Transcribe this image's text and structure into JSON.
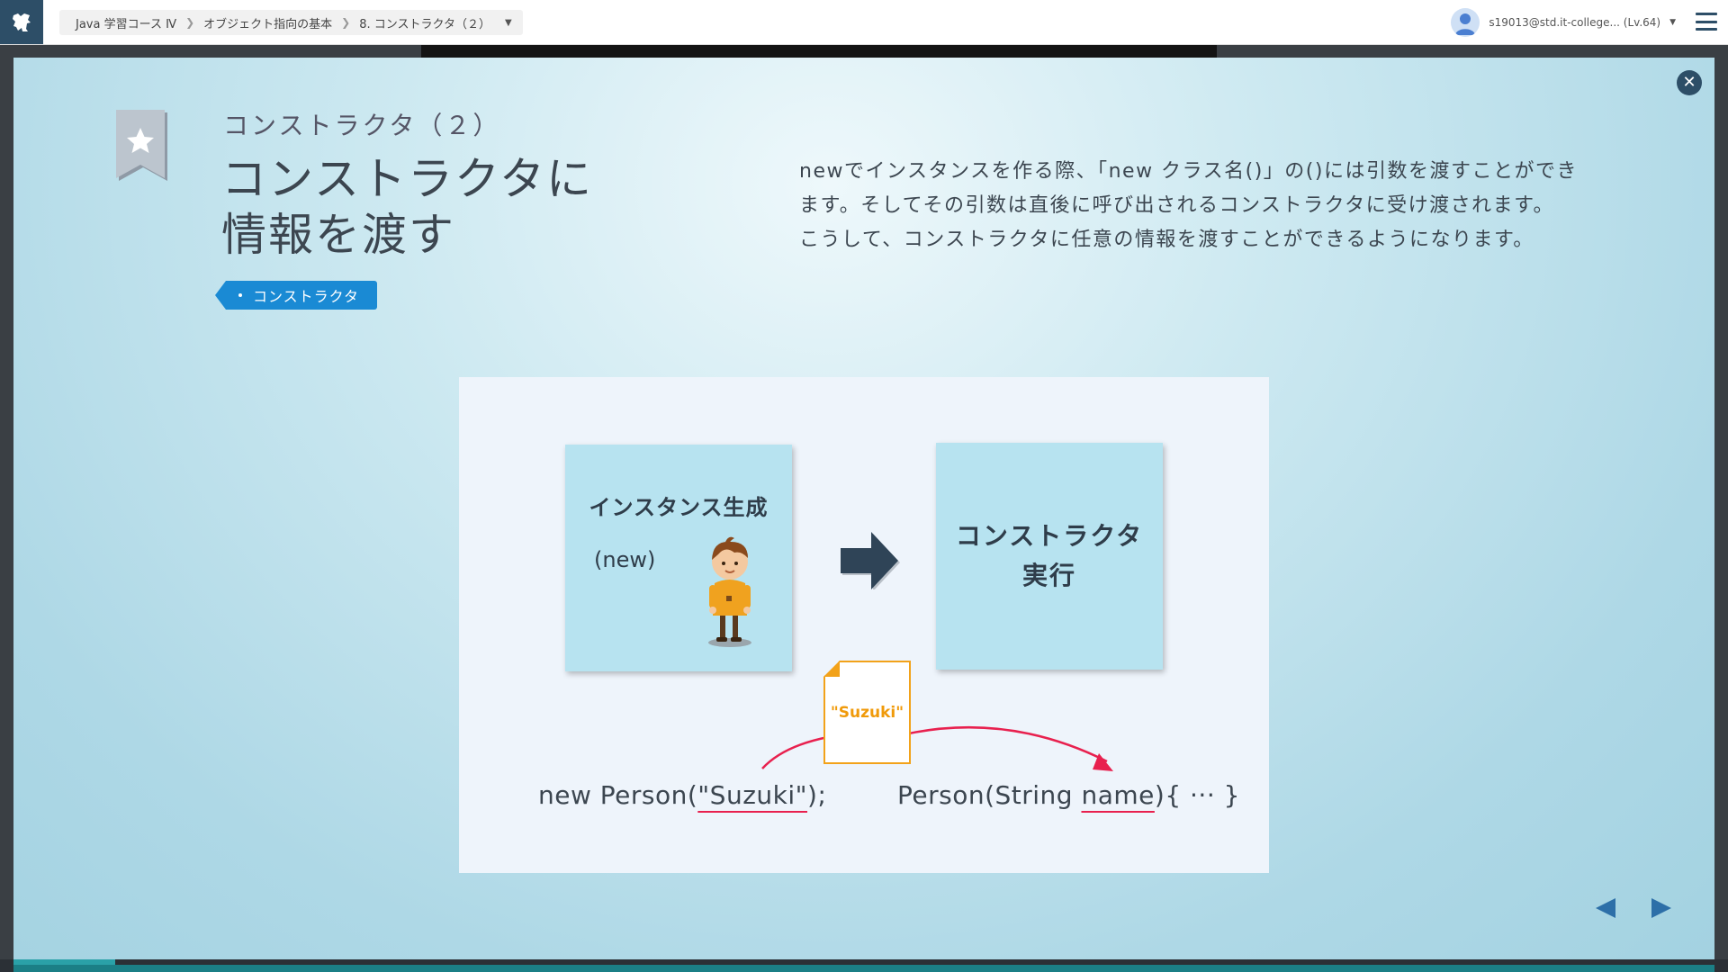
{
  "topbar": {
    "breadcrumb": [
      "Java 学習コース Ⅳ",
      "オブジェクト指向の基本",
      "8. コンストラクタ（２）"
    ],
    "user_label": "s19013@std.it-college... (Lv.64)"
  },
  "lesson": {
    "subtitle": "コンストラクタ（２）",
    "title_line1": "コンストラクタに",
    "title_line2": "情報を渡す",
    "tag": "コンストラクタ",
    "description_p1": "newでインスタンスを作る際、「new クラス名()」の()には引数を渡すことができます。そしてその引数は直後に呼び出されるコンストラクタに受け渡されます。",
    "description_p2": "こうして、コンストラクタに任意の情報を渡すことができるようになります。"
  },
  "figure": {
    "card1_title": "インスタンス生成",
    "card1_sub": "(new)",
    "card2_line1": "コンストラクタ",
    "card2_line2": "実行",
    "note_text": "\"Suzuki\"",
    "code_left_pre": "new Person(",
    "code_left_arg": "\"Suzuki\"",
    "code_left_post": ");",
    "code_right_pre": "Person(String ",
    "code_right_arg": "name",
    "code_right_post": "){ ··· }"
  },
  "progress": {
    "fraction": 0.06
  },
  "colors": {
    "accent": "#1a8ad4",
    "dark": "#2d4e67",
    "highlight": "#e8204e",
    "note": "#f2a21a"
  }
}
